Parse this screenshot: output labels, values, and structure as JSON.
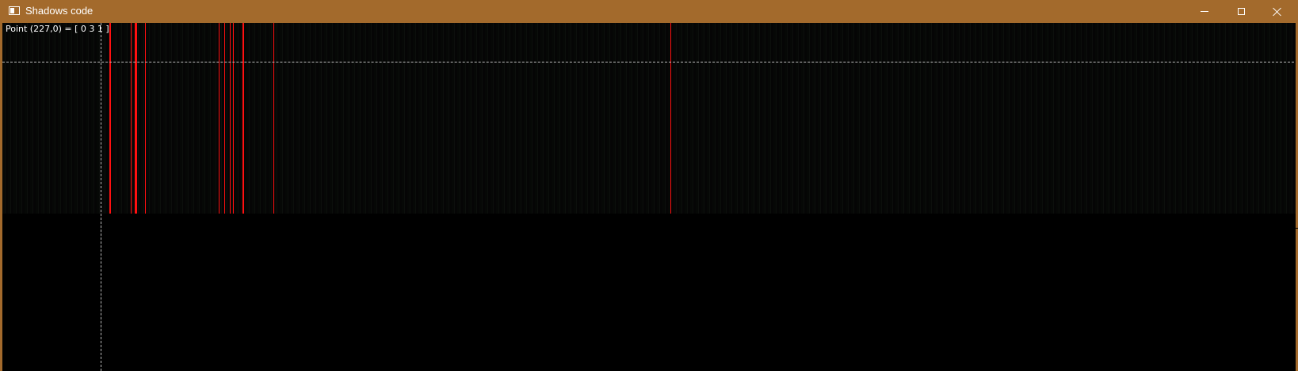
{
  "window": {
    "title": "Shadows code",
    "icon": "app-window-icon",
    "controls": {
      "minimize_icon": "minimize-icon",
      "maximize_icon": "maximize-icon",
      "close_icon": "close-icon"
    }
  },
  "colors": {
    "titlebar": "#a36a2c",
    "canvas": "#000000",
    "highlight_lines": "#ff1010",
    "crosshair": "#bdbdbd"
  },
  "viewer": {
    "status": "Point (227,0) = [ 0 3 1 ]"
  }
}
